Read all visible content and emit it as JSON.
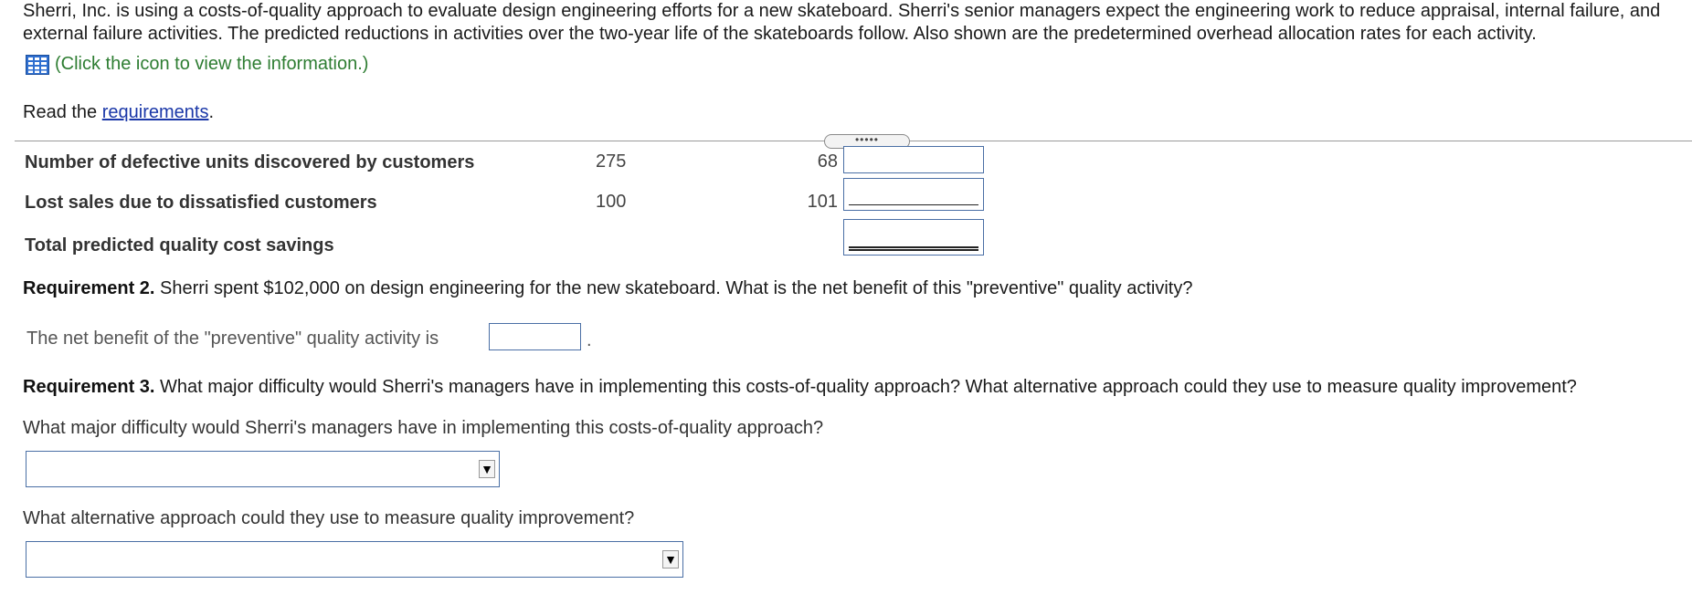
{
  "intro": {
    "paragraph": "Sherri, Inc. is using a costs-of-quality approach to evaluate design engineering efforts for a new skateboard. Sherri's senior managers expect the engineering work to reduce appraisal, internal failure, and external failure activities. The predicted reductions in activities over the two-year life of the skateboards follow. Also shown are the predetermined overhead allocation rates for each activity.",
    "info_link": "(Click the icon to view the information.)",
    "info_icon": "table-grid-icon"
  },
  "read_requirements": {
    "prefix": "Read the ",
    "link": "requirements",
    "suffix": "."
  },
  "expand_pill": "•••••",
  "table": {
    "rows": [
      {
        "label": "Number of defective units discovered by customers",
        "col1": "275",
        "col2": "68"
      },
      {
        "label": "Lost sales due to dissatisfied customers",
        "col1": "100",
        "col2": "101"
      },
      {
        "label": "Total predicted quality cost savings",
        "col1": "",
        "col2": ""
      }
    ]
  },
  "requirement2": {
    "title": "Requirement 2.",
    "text": " Sherri spent $102,000 on design engineering for the new skateboard. What is the net benefit of this \"preventive\" quality activity?",
    "net_label": "The net benefit of the \"preventive\" quality activity is",
    "net_value": "",
    "period": "."
  },
  "requirement3": {
    "title": "Requirement 3.",
    "text": " What major difficulty would Sherri's managers have in implementing this costs-of-quality approach? What alternative approach could they use to measure quality improvement?",
    "q1": "What major difficulty would Sherri's managers have in implementing this costs-of-quality approach?",
    "q1_selected": "",
    "q2": "What alternative approach could they use to measure quality improvement?",
    "q2_selected": "",
    "dropdown_arrow": "▼"
  },
  "colors": {
    "link_blue": "#1a37a8",
    "info_green": "#2e7d32",
    "input_border": "#4a6fa5"
  }
}
